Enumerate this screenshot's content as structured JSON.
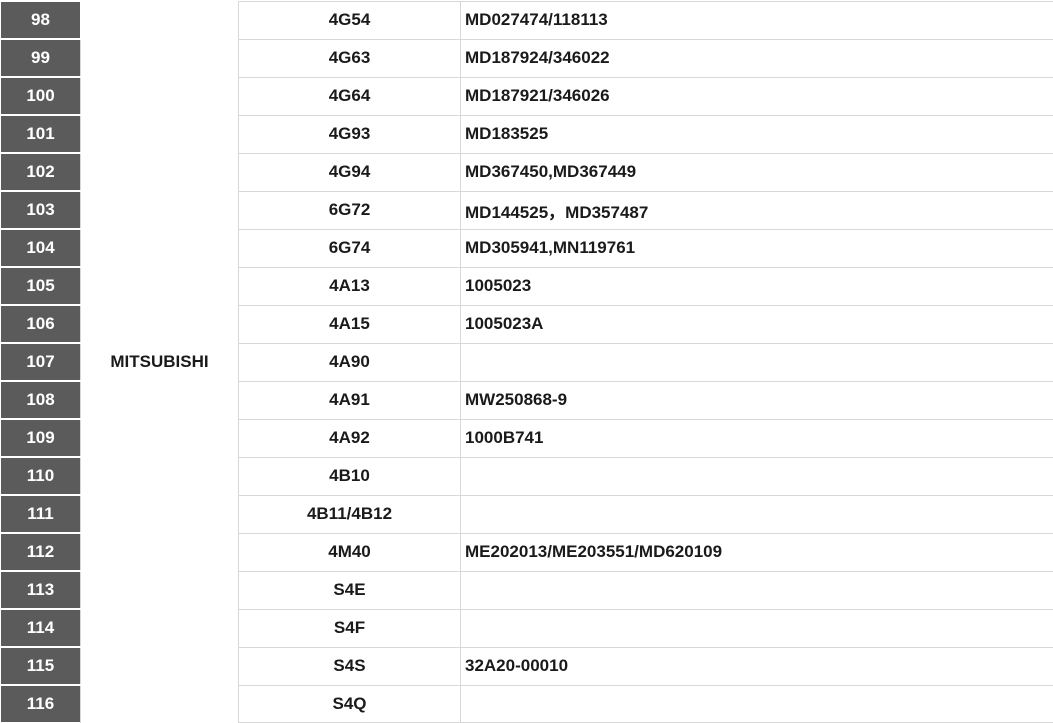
{
  "brand": "MITSUBISHI",
  "rows": [
    {
      "num": "98",
      "engine": "4G54",
      "parts": "MD027474/118113"
    },
    {
      "num": "99",
      "engine": "4G63",
      "parts": "MD187924/346022"
    },
    {
      "num": "100",
      "engine": "4G64",
      "parts": "MD187921/346026"
    },
    {
      "num": "101",
      "engine": "4G93",
      "parts": "MD183525"
    },
    {
      "num": "102",
      "engine": "4G94",
      "parts": "MD367450,MD367449"
    },
    {
      "num": "103",
      "engine": "6G72",
      "parts": "MD144525，MD357487"
    },
    {
      "num": "104",
      "engine": "6G74",
      "parts": "MD305941,MN119761"
    },
    {
      "num": "105",
      "engine": "4A13",
      "parts": "1005023"
    },
    {
      "num": "106",
      "engine": "4A15",
      "parts": "1005023A"
    },
    {
      "num": "107",
      "engine": "4A90",
      "parts": ""
    },
    {
      "num": "108",
      "engine": "4A91",
      "parts": "MW250868-9"
    },
    {
      "num": "109",
      "engine": "4A92",
      "parts": "1000B741"
    },
    {
      "num": "110",
      "engine": "4B10",
      "parts": ""
    },
    {
      "num": "111",
      "engine": "4B11/4B12",
      "parts": ""
    },
    {
      "num": "112",
      "engine": "4M40",
      "parts": "ME202013/ME203551/MD620109"
    },
    {
      "num": "113",
      "engine": "S4E",
      "parts": ""
    },
    {
      "num": "114",
      "engine": "S4F",
      "parts": ""
    },
    {
      "num": "115",
      "engine": "S4S",
      "parts": "32A20-00010"
    },
    {
      "num": "116",
      "engine": "S4Q",
      "parts": ""
    }
  ]
}
